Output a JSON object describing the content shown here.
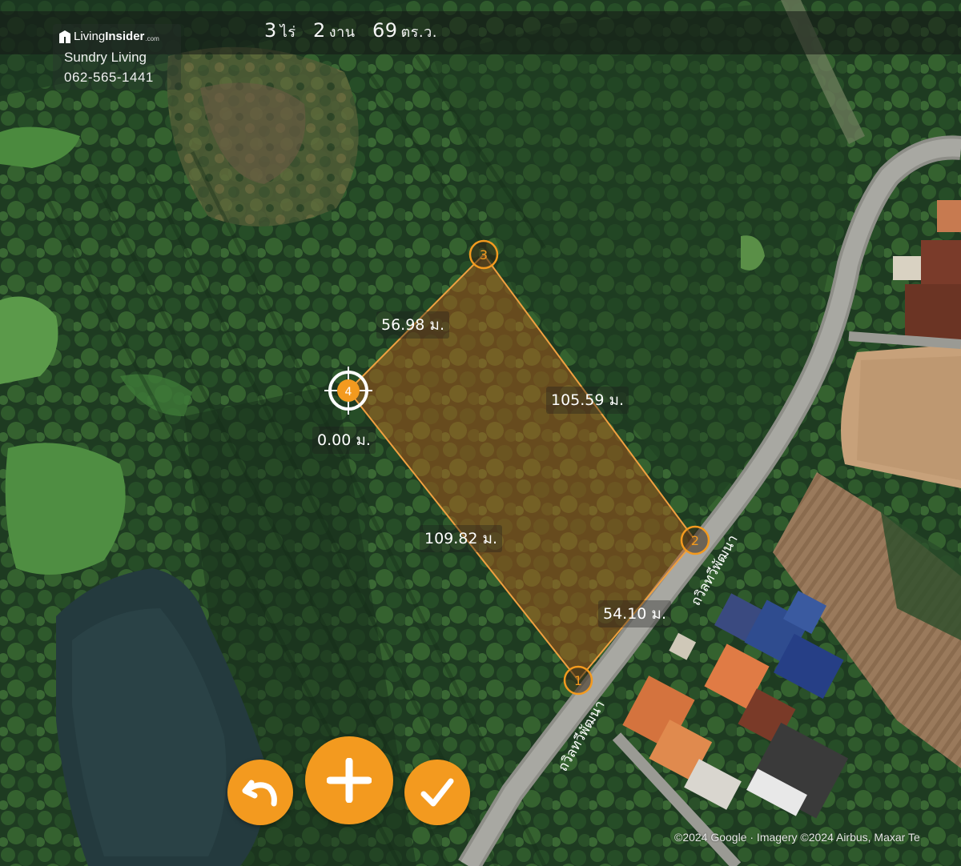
{
  "header": {
    "rai_value": "3",
    "rai_unit": "ไร่",
    "ngan_value": "2",
    "ngan_unit": "งาน",
    "wa_value": "69",
    "wa_unit": "ตร.ว."
  },
  "branding": {
    "logo_name_light": "Living",
    "logo_name_bold": "Insider",
    "logo_suffix": ".com",
    "agent_name": "Sundry Living",
    "agent_phone": "062-565-1441"
  },
  "plot": {
    "fill_color": "#c0601a",
    "outline_color": "#f0a040",
    "marker_color": "#f39a1f",
    "vertices": [
      {
        "label": "1"
      },
      {
        "label": "2"
      },
      {
        "label": "3"
      },
      {
        "label": "4"
      }
    ],
    "edges": {
      "edge_1_2": "54.10 ม.",
      "edge_2_3": "105.59 ม.",
      "edge_3_4": "56.98 ม.",
      "edge_4_1": "109.82 ม.",
      "active_segment": "0.00 ม."
    }
  },
  "map": {
    "road_name": "ถวิลทวีพัฒนา",
    "road_name_2": "ถวิลทวีพัฒนา",
    "credit": "©2024 Google · Imagery ©2024 Airbus, Maxar Te"
  },
  "controls": {
    "undo_icon": "undo-arrow-icon",
    "add_icon": "plus-icon",
    "confirm_icon": "check-icon",
    "accent_color": "#f39a1f"
  }
}
